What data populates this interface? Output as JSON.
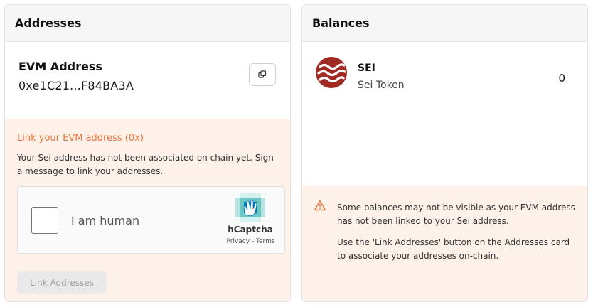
{
  "addresses": {
    "title": "Addresses",
    "evm_label": "EVM Address",
    "evm_value": "0xe1C21...F84BA3A",
    "link_title": "Link your EVM address (0x)",
    "link_description": "Your Sei address has not been associated on chain yet. Sign a message to link your addresses.",
    "captcha": {
      "label": "I am human",
      "brand": "hCaptcha",
      "links": "Privacy - Terms"
    },
    "link_button": "Link Addresses"
  },
  "balances": {
    "title": "Balances",
    "token": {
      "symbol": "SEI",
      "name": "Sei Token",
      "balance": "0"
    },
    "warning_1": "Some balances may not be visible as your EVM address has not been linked to your Sei address.",
    "warning_2": "Use the 'Link Addresses' button on the Addresses card to associate your addresses on-chain."
  },
  "colors": {
    "accent": "#e8763a",
    "sei_brand": "#9e2a23",
    "warning_bg": "#fdf1ea"
  }
}
